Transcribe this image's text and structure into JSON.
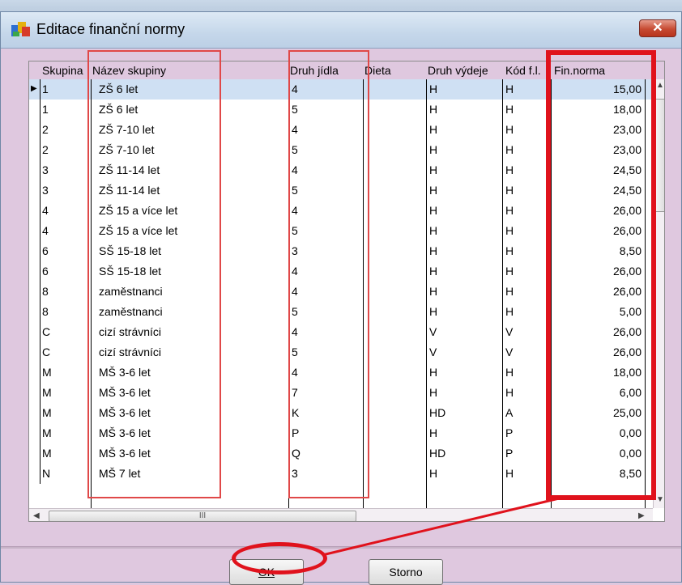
{
  "window": {
    "title": "Editace finanční normy",
    "close_label": "✕"
  },
  "columns": [
    "Skupina",
    "Název skupiny",
    "Druh jídla",
    "Dieta",
    "Druh výdeje",
    "Kód f.l.",
    "Fin.norma"
  ],
  "rows": [
    {
      "skupina": "1",
      "nazev": "ZŠ 6 let",
      "druh": "4",
      "dieta": "",
      "vydej": "H",
      "kod": "H",
      "norma": "15,00"
    },
    {
      "skupina": "1",
      "nazev": "ZŠ 6 let",
      "druh": "5",
      "dieta": "",
      "vydej": "H",
      "kod": "H",
      "norma": "18,00"
    },
    {
      "skupina": "2",
      "nazev": "ZŠ 7-10 let",
      "druh": "4",
      "dieta": "",
      "vydej": "H",
      "kod": "H",
      "norma": "23,00"
    },
    {
      "skupina": "2",
      "nazev": "ZŠ 7-10 let",
      "druh": "5",
      "dieta": "",
      "vydej": "H",
      "kod": "H",
      "norma": "23,00"
    },
    {
      "skupina": "3",
      "nazev": "ZŠ 11-14 let",
      "druh": "4",
      "dieta": "",
      "vydej": "H",
      "kod": "H",
      "norma": "24,50"
    },
    {
      "skupina": "3",
      "nazev": "ZŠ 11-14 let",
      "druh": "5",
      "dieta": "",
      "vydej": "H",
      "kod": "H",
      "norma": "24,50"
    },
    {
      "skupina": "4",
      "nazev": "ZŠ 15 a více let",
      "druh": "4",
      "dieta": "",
      "vydej": "H",
      "kod": "H",
      "norma": "26,00"
    },
    {
      "skupina": "4",
      "nazev": "ZŠ 15 a více let",
      "druh": "5",
      "dieta": "",
      "vydej": "H",
      "kod": "H",
      "norma": "26,00"
    },
    {
      "skupina": "6",
      "nazev": "SŠ 15-18 let",
      "druh": "3",
      "dieta": "",
      "vydej": "H",
      "kod": "H",
      "norma": "8,50"
    },
    {
      "skupina": "6",
      "nazev": "SŠ 15-18 let",
      "druh": "4",
      "dieta": "",
      "vydej": "H",
      "kod": "H",
      "norma": "26,00"
    },
    {
      "skupina": "8",
      "nazev": "zaměstnanci",
      "druh": "4",
      "dieta": "",
      "vydej": "H",
      "kod": "H",
      "norma": "26,00"
    },
    {
      "skupina": "8",
      "nazev": "zaměstnanci",
      "druh": "5",
      "dieta": "",
      "vydej": "H",
      "kod": "H",
      "norma": "5,00"
    },
    {
      "skupina": "C",
      "nazev": "cizí strávníci",
      "druh": "4",
      "dieta": "",
      "vydej": "V",
      "kod": "V",
      "norma": "26,00"
    },
    {
      "skupina": "C",
      "nazev": "cizí strávníci",
      "druh": "5",
      "dieta": "",
      "vydej": "V",
      "kod": "V",
      "norma": "26,00"
    },
    {
      "skupina": "M",
      "nazev": "MŠ 3-6 let",
      "druh": "4",
      "dieta": "",
      "vydej": "H",
      "kod": "H",
      "norma": "18,00"
    },
    {
      "skupina": "M",
      "nazev": "MŠ 3-6 let",
      "druh": "7",
      "dieta": "",
      "vydej": "H",
      "kod": "H",
      "norma": "6,00"
    },
    {
      "skupina": "M",
      "nazev": "MŠ 3-6 let",
      "druh": "K",
      "dieta": "",
      "vydej": "HD",
      "kod": "A",
      "norma": "25,00"
    },
    {
      "skupina": "M",
      "nazev": "MŠ 3-6 let",
      "druh": "P",
      "dieta": "",
      "vydej": "H",
      "kod": "P",
      "norma": "0,00"
    },
    {
      "skupina": "M",
      "nazev": "MŠ 3-6 let",
      "druh": "Q",
      "dieta": "",
      "vydej": "HD",
      "kod": "P",
      "norma": "0,00"
    },
    {
      "skupina": "N",
      "nazev": "MŠ 7 let",
      "druh": "3",
      "dieta": "",
      "vydej": "H",
      "kod": "H",
      "norma": "8,50"
    }
  ],
  "hscroll_grip": "III",
  "buttons": {
    "ok_label": "OK",
    "cancel_label": "Storno"
  }
}
